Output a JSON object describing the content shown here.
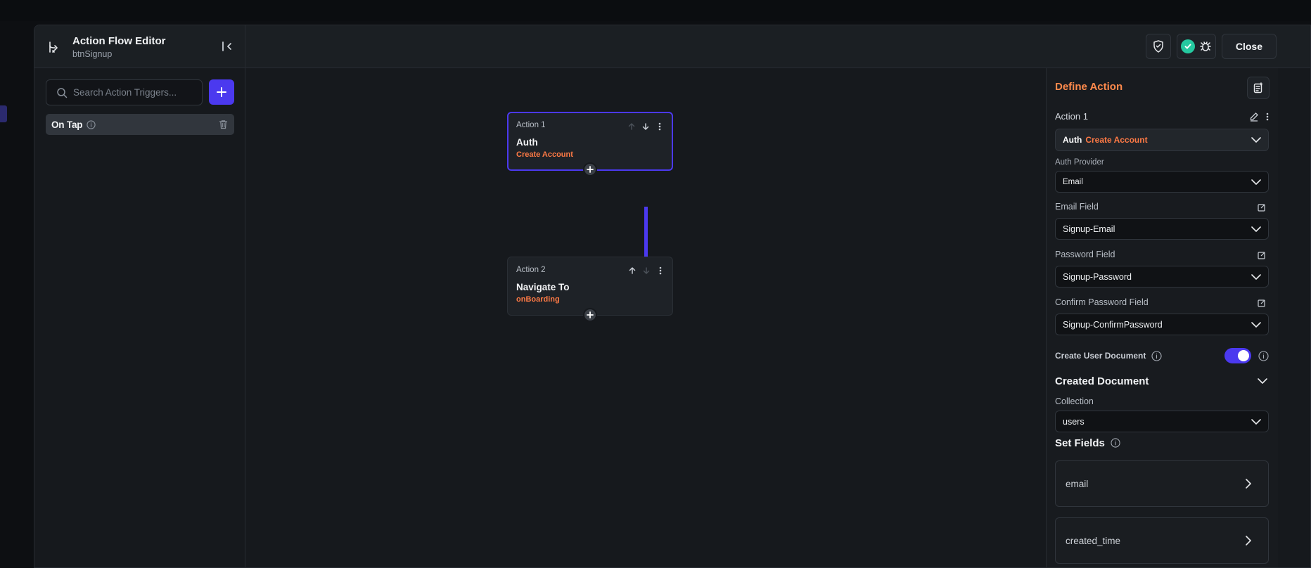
{
  "header": {
    "title": "Action Flow Editor",
    "subtitle": "btnSignup",
    "close_label": "Close"
  },
  "left_panel": {
    "search_placeholder": "Search Action Triggers...",
    "triggers": [
      {
        "label": "On Tap"
      }
    ]
  },
  "canvas": {
    "actions": [
      {
        "number_label": "Action 1",
        "title": "Auth",
        "subtitle": "Create Account",
        "selected": true
      },
      {
        "number_label": "Action 2",
        "title": "Navigate To",
        "subtitle": "onBoarding",
        "selected": false
      }
    ]
  },
  "right_panel": {
    "title": "Define Action",
    "action_label": "Action 1",
    "action_type": "Auth",
    "action_subtype": "Create Account",
    "auth_provider_label": "Auth Provider",
    "auth_provider_value": "Email",
    "email_field_label": "Email Field",
    "email_field_value": "Signup-Email",
    "password_field_label": "Password Field",
    "password_field_value": "Signup-Password",
    "confirm_password_label": "Confirm Password Field",
    "confirm_password_value": "Signup-ConfirmPassword",
    "create_user_doc_label": "Create User Document",
    "create_user_doc_enabled": true,
    "created_document_title": "Created Document",
    "collection_label": "Collection",
    "collection_value": "users",
    "set_fields_title": "Set Fields",
    "fields": [
      {
        "name": "email"
      },
      {
        "name": "created_time"
      }
    ]
  },
  "colors": {
    "accent": "#4b39ef",
    "orange": "#ff7a45",
    "success": "#25c9a0"
  }
}
